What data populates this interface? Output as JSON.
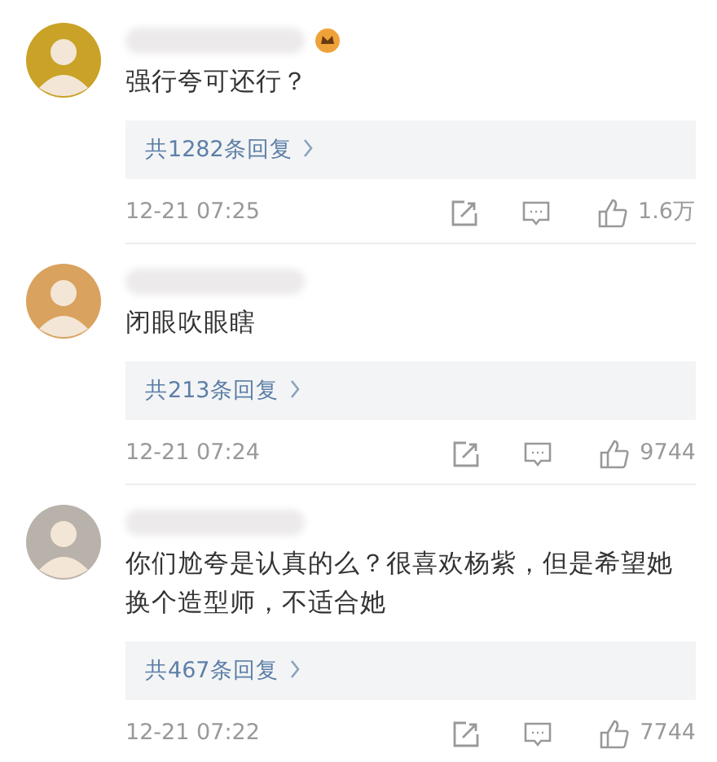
{
  "comments": [
    {
      "avatar": {
        "color": "#c9a227"
      },
      "has_badge": true,
      "text": "强行夸可还行？",
      "replies": "共1282条回复",
      "time": "12-21 07:25",
      "likes": "1.6万"
    },
    {
      "avatar": {
        "color": "#d9a25e"
      },
      "has_badge": false,
      "text": "闭眼吹眼瞎",
      "replies": "共213条回复",
      "time": "12-21 07:24",
      "likes": "9744"
    },
    {
      "avatar": {
        "color": "#b9b2aa"
      },
      "has_badge": false,
      "text": "你们尬夸是认真的么？很喜欢杨紫，但是希望她换个造型师，不适合她",
      "replies": "共467条回复",
      "time": "12-21 07:22",
      "likes": "7744"
    }
  ]
}
